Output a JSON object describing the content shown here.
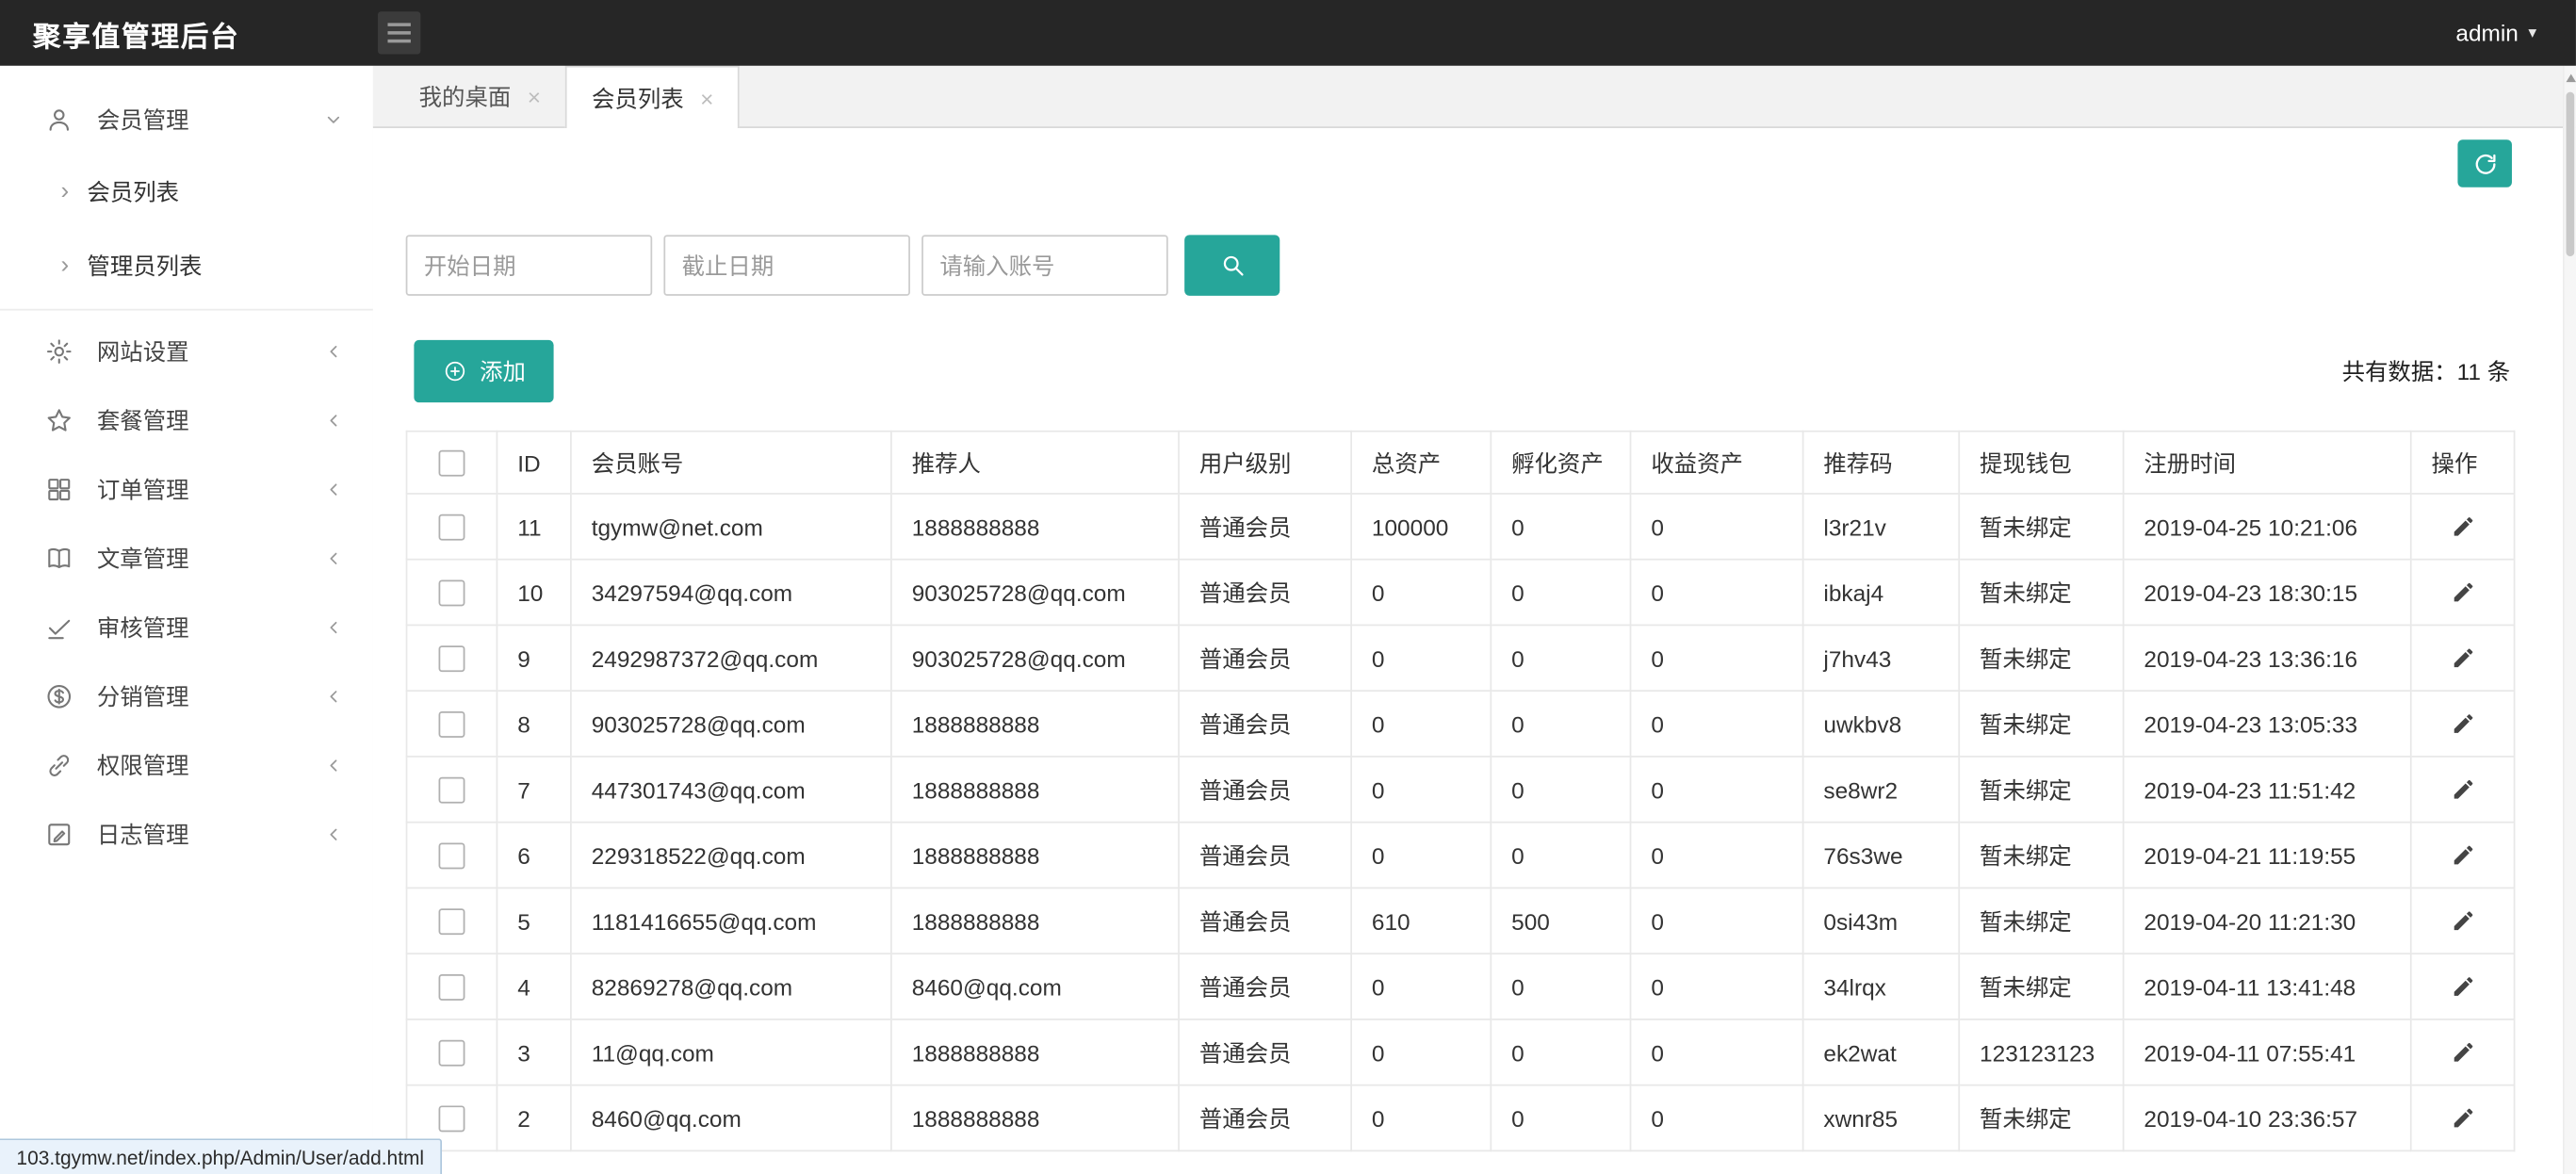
{
  "colors": {
    "accent": "#26a69a",
    "topbar_bg": "#262626"
  },
  "topbar": {
    "title": "聚享值管理后台",
    "user": "admin"
  },
  "sidebar": {
    "groups": [
      {
        "id": "member",
        "icon": "user-icon",
        "label": "会员管理",
        "expanded": true,
        "children": [
          {
            "id": "member-list",
            "label": "会员列表",
            "active": true
          },
          {
            "id": "admin-list",
            "label": "管理员列表",
            "active": false
          }
        ]
      },
      {
        "id": "site",
        "icon": "gear-icon",
        "label": "网站设置",
        "expanded": false
      },
      {
        "id": "package",
        "icon": "star-icon",
        "label": "套餐管理",
        "expanded": false
      },
      {
        "id": "order",
        "icon": "grid-icon",
        "label": "订单管理",
        "expanded": false
      },
      {
        "id": "article",
        "icon": "book-icon",
        "label": "文章管理",
        "expanded": false
      },
      {
        "id": "audit",
        "icon": "check-icon",
        "label": "审核管理",
        "expanded": false
      },
      {
        "id": "distribution",
        "icon": "dollar-icon",
        "label": "分销管理",
        "expanded": false
      },
      {
        "id": "permission",
        "icon": "link-icon",
        "label": "权限管理",
        "expanded": false
      },
      {
        "id": "log",
        "icon": "edit-square-icon",
        "label": "日志管理",
        "expanded": false
      }
    ]
  },
  "tabs": [
    {
      "id": "desktop",
      "label": "我的桌面",
      "active": false
    },
    {
      "id": "member-list",
      "label": "会员列表",
      "active": true
    }
  ],
  "toolbar": {
    "start_date_placeholder": "开始日期",
    "end_date_placeholder": "截止日期",
    "account_placeholder": "请输入账号",
    "add_label": "添加",
    "total_text": "共有数据：11 条"
  },
  "table": {
    "headers": [
      "ID",
      "会员账号",
      "推荐人",
      "用户级别",
      "总资产",
      "孵化资产",
      "收益资产",
      "推荐码",
      "提现钱包",
      "注册时间",
      "操作"
    ],
    "rows": [
      [
        "11",
        "tgymw@net.com",
        "1888888888",
        "普通会员",
        "100000",
        "0",
        "0",
        "l3r21v",
        "暂未绑定",
        "2019-04-25 10:21:06"
      ],
      [
        "10",
        "34297594@qq.com",
        "903025728@qq.com",
        "普通会员",
        "0",
        "0",
        "0",
        "ibkaj4",
        "暂未绑定",
        "2019-04-23 18:30:15"
      ],
      [
        "9",
        "2492987372@qq.com",
        "903025728@qq.com",
        "普通会员",
        "0",
        "0",
        "0",
        "j7hv43",
        "暂未绑定",
        "2019-04-23 13:36:16"
      ],
      [
        "8",
        "903025728@qq.com",
        "1888888888",
        "普通会员",
        "0",
        "0",
        "0",
        "uwkbv8",
        "暂未绑定",
        "2019-04-23 13:05:33"
      ],
      [
        "7",
        "447301743@qq.com",
        "1888888888",
        "普通会员",
        "0",
        "0",
        "0",
        "se8wr2",
        "暂未绑定",
        "2019-04-23 11:51:42"
      ],
      [
        "6",
        "229318522@qq.com",
        "1888888888",
        "普通会员",
        "0",
        "0",
        "0",
        "76s3we",
        "暂未绑定",
        "2019-04-21 11:19:55"
      ],
      [
        "5",
        "1181416655@qq.com",
        "1888888888",
        "普通会员",
        "610",
        "500",
        "0",
        "0si43m",
        "暂未绑定",
        "2019-04-20 11:21:30"
      ],
      [
        "4",
        "82869278@qq.com",
        "8460@qq.com",
        "普通会员",
        "0",
        "0",
        "0",
        "34lrqx",
        "暂未绑定",
        "2019-04-11 13:41:48"
      ],
      [
        "3",
        "11@qq.com",
        "1888888888",
        "普通会员",
        "0",
        "0",
        "0",
        "ek2wat",
        "123123123",
        "2019-04-11 07:55:41"
      ],
      [
        "2",
        "8460@qq.com",
        "1888888888",
        "普通会员",
        "0",
        "0",
        "0",
        "xwnr85",
        "暂未绑定",
        "2019-04-10 23:36:57"
      ]
    ]
  },
  "statusbar": {
    "url": "103.tgymw.net/index.php/Admin/User/add.html"
  }
}
